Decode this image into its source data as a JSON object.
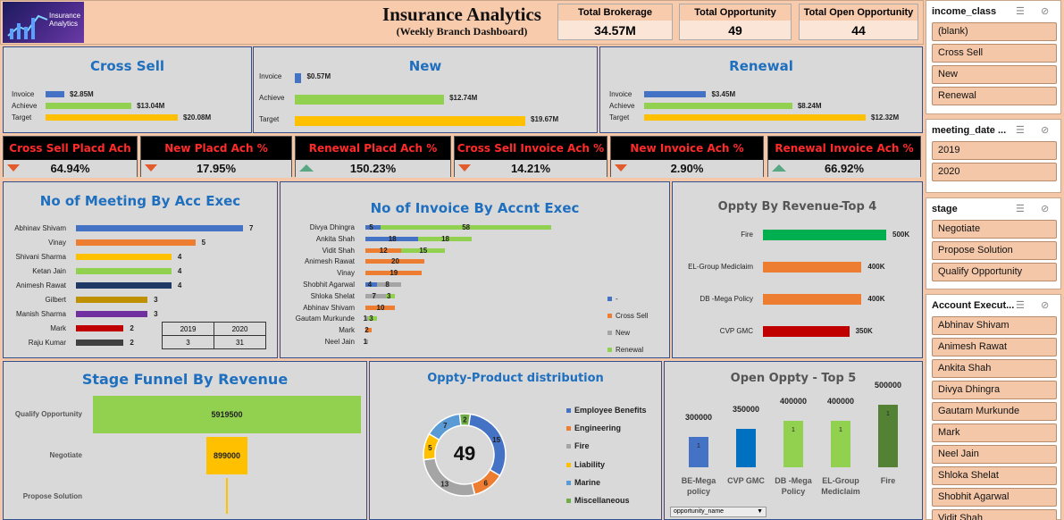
{
  "header": {
    "logo_text": "Insurance Analytics",
    "title": "Insurance Analytics",
    "subtitle": "(Weekly Branch Dashboard)",
    "cards": [
      {
        "label": "Total Brokerage",
        "value": "34.57M"
      },
      {
        "label": "Total Opportunity",
        "value": "49"
      },
      {
        "label": "Total Open Opportunity",
        "value": "44"
      }
    ]
  },
  "cross_sell": {
    "title": "Cross Sell",
    "rows": [
      {
        "label": "Invoice",
        "value": "$2.85M",
        "color": "#4472c4"
      },
      {
        "label": "Achieve",
        "value": "$13.04M",
        "color": "#92d050"
      },
      {
        "label": "Target",
        "value": "$20.08M",
        "color": "#ffc000"
      }
    ]
  },
  "new": {
    "title": "New",
    "rows": [
      {
        "label": "Invoice",
        "value": "$0.57M",
        "color": "#4472c4"
      },
      {
        "label": "Achieve",
        "value": "$12.74M",
        "color": "#92d050"
      },
      {
        "label": "Target",
        "value": "$19.67M",
        "color": "#ffc000"
      }
    ]
  },
  "renewal": {
    "title": "Renewal",
    "rows": [
      {
        "label": "Invoice",
        "value": "$3.45M",
        "color": "#4472c4"
      },
      {
        "label": "Achieve",
        "value": "$8.24M",
        "color": "#92d050"
      },
      {
        "label": "Target",
        "value": "$12.32M",
        "color": "#ffc000"
      }
    ]
  },
  "kpis": [
    {
      "label": "Cross Sell Placd Ach %",
      "value": "64.94%",
      "trend": "down"
    },
    {
      "label": "New Placd Ach %",
      "value": "17.95%",
      "trend": "down"
    },
    {
      "label": "Renewal Placd Ach %",
      "value": "150.23%",
      "trend": "up"
    },
    {
      "label": "Cross Sell Invoice Ach %",
      "value": "14.21%",
      "trend": "down"
    },
    {
      "label": "New Invoice Ach %",
      "value": "2.90%",
      "trend": "down"
    },
    {
      "label": "Renewal Invoice Ach %",
      "value": "66.92%",
      "trend": "up"
    }
  ],
  "meetings": {
    "title": "No of Meeting By Acc Exec",
    "table": {
      "years": [
        "2019",
        "2020"
      ],
      "values": [
        "3",
        "31"
      ]
    }
  },
  "invoices": {
    "title": "No of Invoice By Accnt Exec",
    "legend": [
      {
        "label": "-",
        "color": "#4472c4"
      },
      {
        "label": "Cross Sell",
        "color": "#ed7d31"
      },
      {
        "label": "New",
        "color": "#a5a5a5"
      },
      {
        "label": "Renewal",
        "color": "#92d050"
      }
    ]
  },
  "top4": {
    "title": "Oppty By Revenue-Top 4"
  },
  "funnel": {
    "title": "Stage Funnel By Revenue"
  },
  "product": {
    "title": "Oppty-Product distribution",
    "center": "49",
    "legend": [
      {
        "label": "Employee Benefits",
        "color": "#4472c4"
      },
      {
        "label": "Engineering",
        "color": "#ed7d31"
      },
      {
        "label": "Fire",
        "color": "#a5a5a5"
      },
      {
        "label": "Liability",
        "color": "#ffc000"
      },
      {
        "label": "Marine",
        "color": "#5b9bd5"
      },
      {
        "label": "Miscellaneous",
        "color": "#70ad47"
      }
    ]
  },
  "open_top5": {
    "title": "Open Oppty - Top 5",
    "filter_label": "opportunity_name"
  },
  "slicers": [
    {
      "title": "income_class",
      "items": [
        "(blank)",
        "Cross Sell",
        "New",
        "Renewal"
      ]
    },
    {
      "title": "meeting_date ...",
      "items": [
        "2019",
        "2020"
      ]
    },
    {
      "title": "stage",
      "items": [
        "Negotiate",
        "Propose Solution",
        "Qualify Opportunity"
      ]
    },
    {
      "title": "Account Execut...",
      "items": [
        "Abhinav Shivam",
        "Animesh Rawat",
        "Ankita Shah",
        "Divya Dhingra",
        "Gautam Murkunde",
        "Mark",
        "Neel Jain",
        "Shloka Shelat",
        "Shobhit Agarwal",
        "Vidit Shah"
      ]
    }
  ],
  "chart_data": [
    {
      "type": "bar",
      "title": "Cross Sell",
      "categories": [
        "Invoice",
        "Achieve",
        "Target"
      ],
      "values": [
        2.85,
        13.04,
        20.08
      ]
    },
    {
      "type": "bar",
      "title": "New",
      "categories": [
        "Invoice",
        "Achieve",
        "Target"
      ],
      "values": [
        0.57,
        12.74,
        19.67
      ]
    },
    {
      "type": "bar",
      "title": "Renewal",
      "categories": [
        "Invoice",
        "Achieve",
        "Target"
      ],
      "values": [
        3.45,
        8.24,
        12.32
      ]
    },
    {
      "type": "bar",
      "title": "No of Meeting By Acc Exec",
      "categories": [
        "Abhinav Shivam",
        "Vinay",
        "Shivani Sharma",
        "Ketan Jain",
        "Animesh Rawat",
        "Gilbert",
        "Manish Sharma",
        "Mark",
        "Raju Kumar"
      ],
      "values": [
        7,
        5,
        4,
        4,
        4,
        3,
        3,
        2,
        2
      ],
      "colors": [
        "#4472c4",
        "#ed7d31",
        "#ffc000",
        "#92d050",
        "#1f3864",
        "#bf9000",
        "#7030a0",
        "#c00000",
        "#404040"
      ]
    },
    {
      "type": "bar",
      "title": "No of Invoice By Accnt Exec",
      "categories": [
        "Divya Dhingra",
        "Ankita Shah",
        "Vidit Shah",
        "Animesh Rawat",
        "Vinay",
        "Shobhit Agarwal",
        "Shloka Shelat",
        "Abhinav Shivam",
        "Gautam Murkunde",
        "Mark",
        "Neel Jain"
      ],
      "series": [
        {
          "name": "-",
          "values": [
            5,
            18,
            0,
            0,
            0,
            4,
            0,
            0,
            0,
            0,
            0
          ]
        },
        {
          "name": "Cross Sell",
          "values": [
            0,
            0,
            12,
            20,
            19,
            0,
            0,
            10,
            0,
            2,
            0
          ]
        },
        {
          "name": "New",
          "values": [
            0,
            0,
            0,
            0,
            0,
            8,
            7,
            0,
            1,
            0,
            1
          ]
        },
        {
          "name": "Renewal",
          "values": [
            58,
            18,
            15,
            0,
            0,
            0,
            3,
            0,
            3,
            0,
            0
          ]
        }
      ]
    },
    {
      "type": "bar",
      "title": "Oppty By Revenue-Top 4",
      "categories": [
        "Fire",
        "EL-Group Mediclaim",
        "DB -Mega Policy",
        "CVP GMC"
      ],
      "values": [
        500000,
        400000,
        400000,
        350000
      ],
      "labels": [
        "500K",
        "400K",
        "400K",
        "350K"
      ],
      "colors": [
        "#00b050",
        "#ed7d31",
        "#ed7d31",
        "#c00000"
      ]
    },
    {
      "type": "bar",
      "title": "Stage Funnel By Revenue",
      "categories": [
        "Qualify Opportunity",
        "Negotiate",
        "Propose Solution"
      ],
      "values": [
        5919500,
        899000,
        0
      ]
    },
    {
      "type": "pie",
      "title": "Oppty-Product distribution",
      "categories": [
        "Employee Benefits",
        "Engineering",
        "Fire",
        "Liability",
        "Marine",
        "Miscellaneous"
      ],
      "values": [
        15,
        6,
        13,
        5,
        7,
        2
      ]
    },
    {
      "type": "bar",
      "title": "Open Oppty - Top 5",
      "categories": [
        "BE-Mega policy",
        "CVP GMC",
        "DB -Mega Policy",
        "EL-Group Mediclaim",
        "Fire"
      ],
      "values": [
        300000,
        350000,
        400000,
        400000,
        500000
      ],
      "colors": [
        "#4472c4",
        "#0070c0",
        "#92d050",
        "#92d050",
        "#548235"
      ],
      "counts": [
        "1",
        "",
        "1",
        "1",
        "1"
      ]
    }
  ]
}
